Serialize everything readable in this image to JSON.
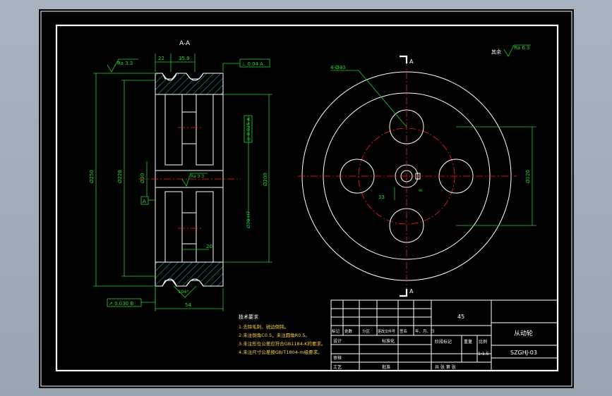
{
  "drawing": {
    "section_label": "A-A",
    "view_label": "A",
    "roughness_side": "Ra 3.3",
    "roughness_general_prefix": "其余",
    "roughness_general": "Ra 6.3",
    "roughness_bore": "Ra 3.3",
    "dim_top_a": "22",
    "dim_top_b": "35.9",
    "perp_tolerance": "⊥ 0.04 A",
    "coax_tolerance": "◎ 0.025 A",
    "runout_tolerance": "↗ 0.030 B",
    "datum_a": "A",
    "dim_dia_250": "Ø250",
    "dim_dia_228": "Ø228",
    "dim_dia_30": "Ø30",
    "dim_dia_200": "Ø200",
    "dim_bore_tol": "Ø30 H7",
    "dim_width": "54",
    "dim_inner_20": "20",
    "dim_angle": "104°",
    "hole_callout": "4-Ø40",
    "dim_pcd": "Ø120",
    "dim_keyway_33": "33",
    "dim_keyway_8": "8"
  },
  "notes": {
    "title": "技术要求",
    "items": [
      "1.去除毛刺、锐边倒钝。",
      "2.未注倒角C0.5，未注圆角R0.5。",
      "3.未注形位公差应符合GB1184-K的要求。",
      "4.未注尺寸公差按GB/T1804-m级要求。"
    ]
  },
  "title_block": {
    "material": "45",
    "part_name": "从动轮",
    "drawing_no": "SZGHJ-03",
    "row_labels": [
      "标记",
      "处数",
      "分区",
      "更改文件号",
      "签名",
      "年、月、日"
    ],
    "design": "设计",
    "standardize": "标准化",
    "stage_mark": "阶段标记",
    "weight": "重量",
    "scale_label": "比例",
    "scale": "1:1.5",
    "review": "审核",
    "process": "工艺",
    "approve": "批准",
    "sheets": "共    张   第    张"
  }
}
